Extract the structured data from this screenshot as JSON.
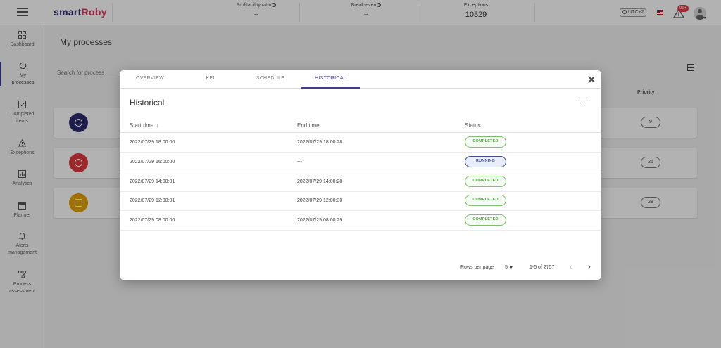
{
  "app": {
    "logo_main": "smart",
    "logo_accent": "Roby"
  },
  "metrics": [
    {
      "label": "Profitability ratio",
      "value": "--"
    },
    {
      "label": "Break-even",
      "value": "--"
    },
    {
      "label": "Exceptions",
      "value": "10329"
    }
  ],
  "header": {
    "timezone": "UTC+2",
    "alerts_badge": "99+"
  },
  "sidebar": {
    "items": [
      {
        "label": "Dashboard",
        "icon": "dashboard-icon"
      },
      {
        "label": "My processes",
        "icon": "processes-icon"
      },
      {
        "label": "Completed items",
        "icon": "checkbox-icon"
      },
      {
        "label": "Exceptions",
        "icon": "warning-icon"
      },
      {
        "label": "Analytics",
        "icon": "chart-icon"
      },
      {
        "label": "Planner",
        "icon": "calendar-icon"
      },
      {
        "label": "Alerts management",
        "icon": "bell-icon"
      },
      {
        "label": "Process assessment",
        "icon": "flow-icon"
      }
    ]
  },
  "main": {
    "title": "My processes",
    "search_placeholder": "Search for process",
    "priority_header": "Priority",
    "processes": [
      {
        "priority": "9",
        "icon_color": "#2b2a6e"
      },
      {
        "priority": "26",
        "icon_color": "#e03a3e"
      },
      {
        "priority": "28",
        "icon_color": "#e6a100"
      }
    ]
  },
  "modal": {
    "tabs": [
      "OVERVIEW",
      "KPI",
      "SCHEDULE",
      "HISTORICAL"
    ],
    "active_tab": "HISTORICAL",
    "title": "Historical",
    "columns": [
      "Start time",
      "End time",
      "Status"
    ],
    "rows": [
      {
        "start": "2022/07/29 18:00:00",
        "end": "2022/07/29 18:00:28",
        "status": "COMPLETED"
      },
      {
        "start": "2022/07/29 16:00:00",
        "end": "---",
        "status": "RUNNING"
      },
      {
        "start": "2022/07/29 14:00:01",
        "end": "2022/07/29 14:00:28",
        "status": "COMPLETED"
      },
      {
        "start": "2022/07/29 12:00:01",
        "end": "2022/07/29 12:00:30",
        "status": "COMPLETED"
      },
      {
        "start": "2022/07/29 08:00:00",
        "end": "2022/07/29 08:00:29",
        "status": "COMPLETED"
      }
    ],
    "pagination": {
      "rows_per_page_label": "Rows per page",
      "rows_per_page": "5",
      "range": "1-5 of 2757"
    }
  }
}
